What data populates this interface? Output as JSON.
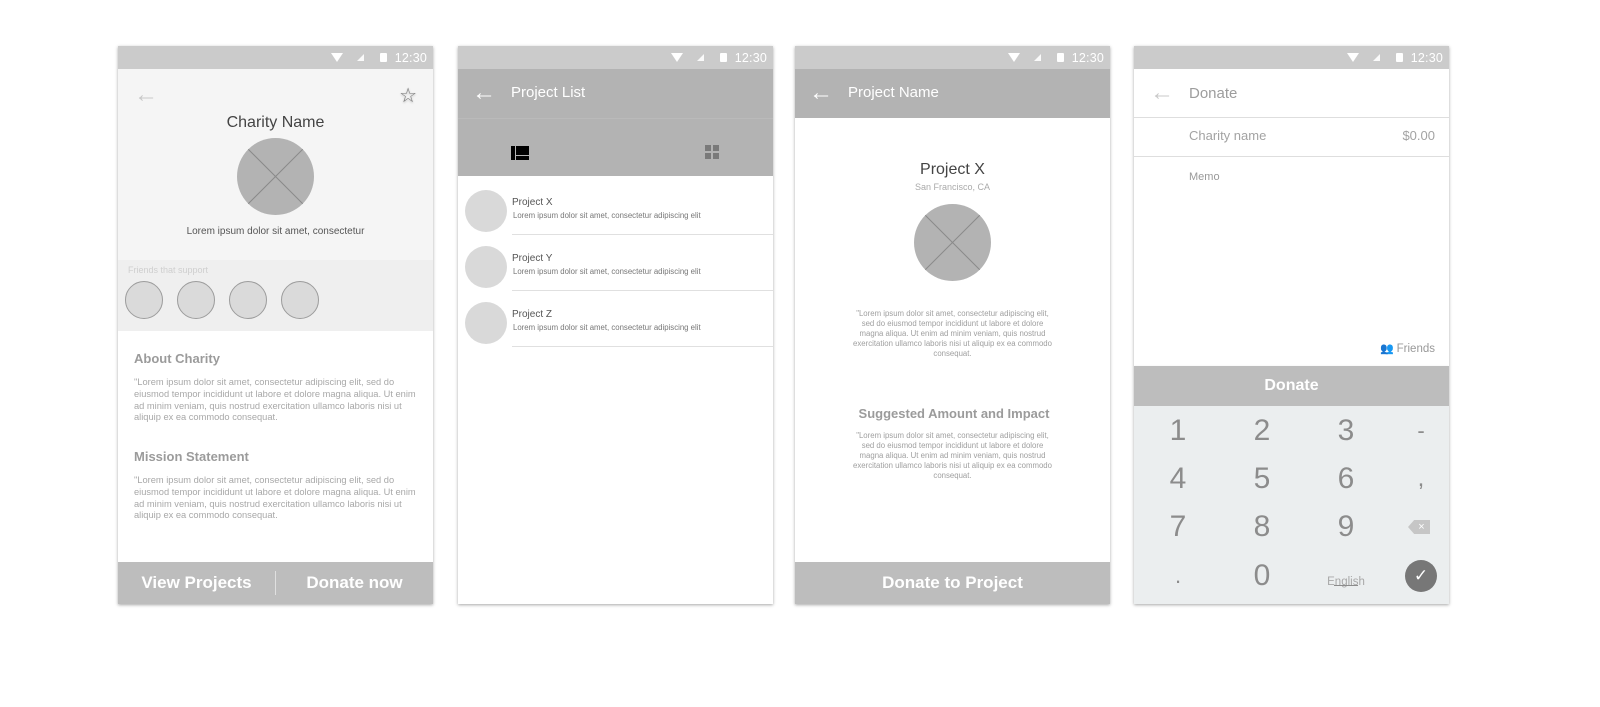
{
  "status_bar": {
    "time": "12:30"
  },
  "charity_screen": {
    "title": "Charity Name",
    "subtitle": "Lorem ipsum dolor sit amet, consectetur",
    "friends_label": "Friends that support",
    "friends_count": 4,
    "about_heading": "About Charity",
    "about_text": "\"Lorem ipsum dolor sit amet, consectetur adipiscing elit, sed do eiusmod tempor incididunt ut labore et dolore magna aliqua. Ut enim ad minim veniam, quis nostrud exercitation ullamco laboris nisi ut aliquip ex ea commodo consequat.",
    "mission_heading": "Mission Statement",
    "mission_text": "\"Lorem ipsum dolor sit amet, consectetur adipiscing elit, sed do eiusmod tempor incididunt ut labore et dolore magna aliqua. Ut enim ad minim veniam, quis nostrud exercitation ullamco laboris nisi ut aliquip ex ea commodo consequat.",
    "view_projects_label": "View Projects",
    "donate_now_label": "Donate now"
  },
  "project_list_screen": {
    "title": "Project List",
    "items": [
      {
        "title": "Project X",
        "subtitle": "Lorem ipsum dolor sit amet, consectetur adipiscing elit"
      },
      {
        "title": "Project Y",
        "subtitle": "Lorem ipsum dolor sit amet, consectetur adipiscing elit"
      },
      {
        "title": "Project Z",
        "subtitle": "Lorem ipsum dolor sit amet, consectetur adipiscing elit"
      }
    ]
  },
  "project_screen": {
    "appbar_title": "Project Name",
    "title": "Project X",
    "location": "San Francisco, CA",
    "description": "\"Lorem ipsum dolor sit amet, consectetur adipiscing elit, sed do eiusmod tempor incididunt ut labore et dolore magna aliqua. Ut enim ad minim veniam, quis nostrud exercitation ullamco laboris nisi ut aliquip ex ea commodo consequat.",
    "suggested_heading": "Suggested Amount and Impact",
    "suggested_text": "\"Lorem ipsum dolor sit amet, consectetur adipiscing elit, sed do eiusmod tempor incididunt ut labore et dolore magna aliqua. Ut enim ad minim veniam, quis nostrud exercitation ullamco laboris nisi ut aliquip ex ea commodo consequat.",
    "donate_label": "Donate to Project"
  },
  "donate_screen": {
    "title": "Donate",
    "charity_name": "Charity name",
    "amount": "$0.00",
    "memo_placeholder": "Memo",
    "friends_label": "Friends",
    "donate_label": "Donate",
    "keypad": {
      "keys": [
        "1",
        "2",
        "3",
        "-",
        "4",
        "5",
        "6",
        ",",
        "7",
        "8",
        "9",
        "backspace",
        ".",
        "0",
        "English",
        "enter"
      ],
      "language_label": "English"
    }
  }
}
